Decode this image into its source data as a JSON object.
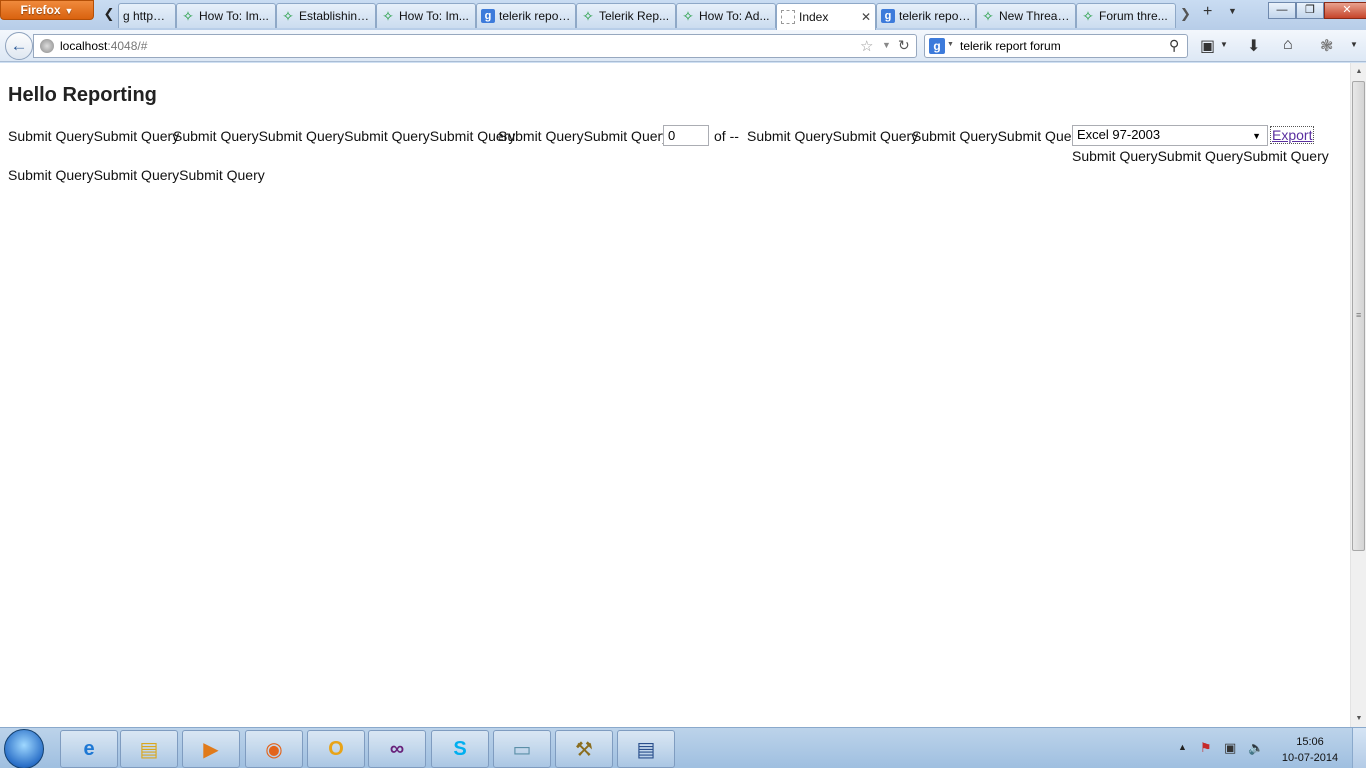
{
  "browser": {
    "menu_button": "Firefox",
    "tabs": [
      {
        "label": "g https ...",
        "icon": "none"
      },
      {
        "label": "How To: Im...",
        "icon": "telerik-icon"
      },
      {
        "label": "Establishing...",
        "icon": "telerik-icon"
      },
      {
        "label": "How To: Im...",
        "icon": "telerik-icon"
      },
      {
        "label": "telerik repor...",
        "icon": "google-icon"
      },
      {
        "label": "Telerik Rep...",
        "icon": "telerik-icon"
      },
      {
        "label": "How To: Ad...",
        "icon": "telerik-icon"
      },
      {
        "label": "Index",
        "icon": "blank-page-icon",
        "active": true
      },
      {
        "label": "telerik repor...",
        "icon": "google-icon"
      },
      {
        "label": "New Thread...",
        "icon": "telerik-icon"
      },
      {
        "label": "Forum thre...",
        "icon": "telerik-icon"
      }
    ],
    "url_host": "localhost",
    "url_rest": ":4048/#",
    "search_query": "telerik report forum"
  },
  "page": {
    "title": "Hello Reporting",
    "toolbar": {
      "group1": "Submit QuerySubmit Query",
      "group2": "Submit QuerySubmit QuerySubmit QuerySubmit Query",
      "group3": "Submit QuerySubmit Query",
      "page_number": "0",
      "page_of": "of --",
      "group4": "Submit QuerySubmit Query",
      "group5": "Submit QuerySubmit Query",
      "export_format": "Excel 97-2003",
      "export_label": "Export",
      "group6": "Submit QuerySubmit QuerySubmit Query",
      "group7": "Submit QuerySubmit QuerySubmit Query"
    }
  },
  "taskbar": {
    "apps": [
      "internet-explorer-icon",
      "file-explorer-icon",
      "media-player-icon",
      "firefox-icon",
      "outlook-icon",
      "visual-studio-icon",
      "skype-icon",
      "notepad-icon",
      "setup-tool-icon",
      "remote-desktop-icon"
    ],
    "clock_time": "15:06",
    "clock_date": "10-07-2014"
  }
}
